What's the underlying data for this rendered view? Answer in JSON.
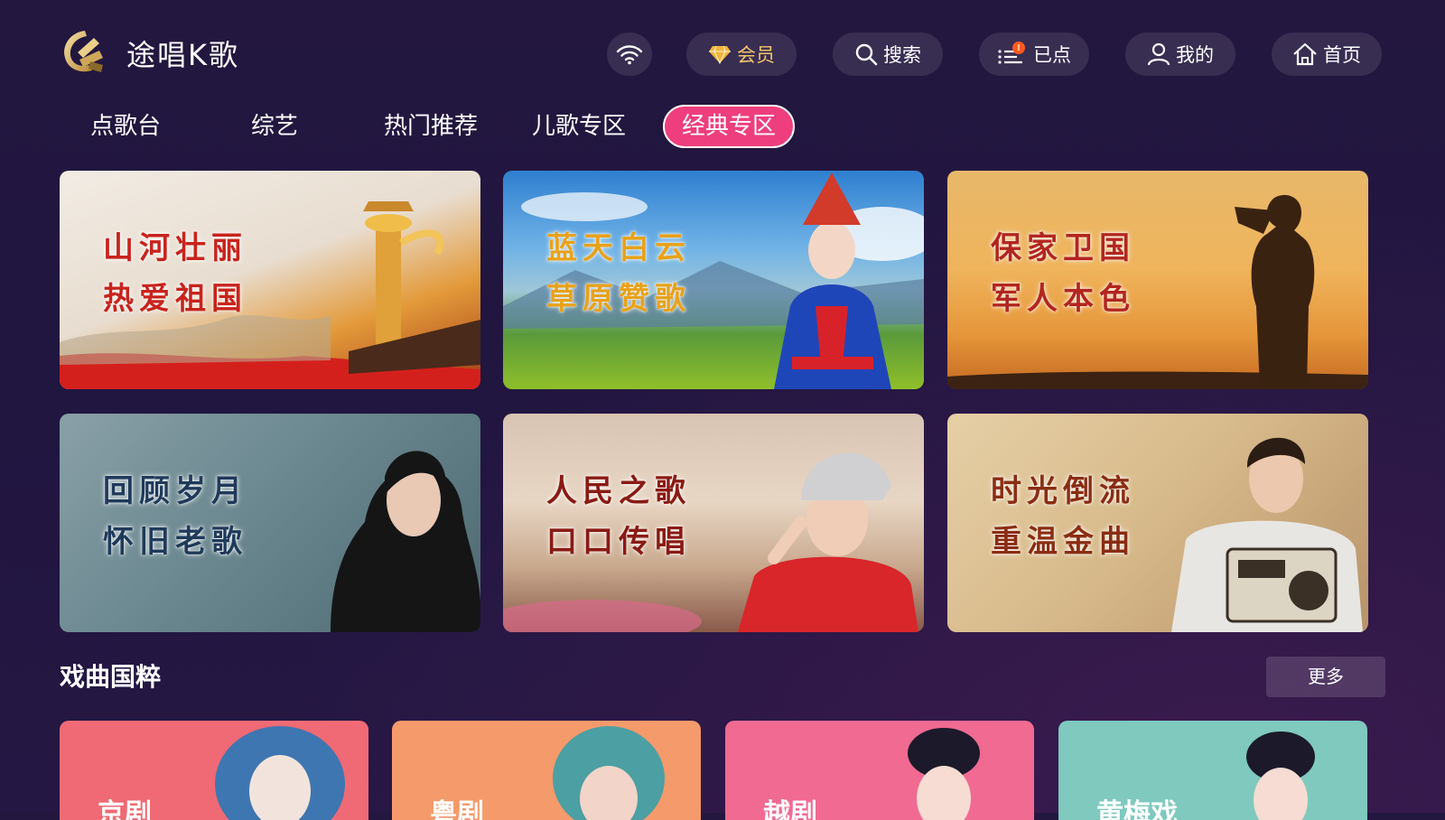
{
  "app": {
    "title": "途唱K歌"
  },
  "header": {
    "wifi": {
      "icon": "wifi-icon"
    },
    "member": {
      "label": "会员",
      "icon": "diamond-icon",
      "icon_color": "#f0b43a"
    },
    "search": {
      "label": "搜索",
      "icon": "search-icon"
    },
    "queued": {
      "label": "已点",
      "icon": "playlist-icon",
      "badge_color": "#ff5a1f"
    },
    "mine": {
      "label": "我的",
      "icon": "user-icon"
    },
    "home": {
      "label": "首页",
      "icon": "home-icon"
    }
  },
  "tabs": [
    {
      "label": "点歌台",
      "active": false
    },
    {
      "label": "综艺",
      "active": false
    },
    {
      "label": "热门推荐",
      "active": false
    },
    {
      "label": "儿歌专区",
      "active": false
    },
    {
      "label": "经典专区",
      "active": true
    }
  ],
  "colors": {
    "accent": "#ee3e7d",
    "background": "#211640"
  },
  "banners": [
    {
      "line1": "山河壮丽",
      "line2": "热爱祖国",
      "text_color": "#c8231c"
    },
    {
      "line1": "蓝天白云",
      "line2": "草原赞歌",
      "text_color": "#e8a21a"
    },
    {
      "line1": "保家卫国",
      "line2": "军人本色",
      "text_color": "#b3261e"
    },
    {
      "line1": "回顾岁月",
      "line2": "怀旧老歌",
      "text_color": "#1f3a5a"
    },
    {
      "line1": "人民之歌",
      "line2": "口口传唱",
      "text_color": "#8a1a14"
    },
    {
      "line1": "时光倒流",
      "line2": "重温金曲",
      "text_color": "#8a2d12"
    }
  ],
  "opera_section": {
    "title": "戏曲国粹",
    "more_label": "更多",
    "items": [
      {
        "name": "京剧",
        "color": "#ef6a74"
      },
      {
        "name": "粤剧",
        "color": "#f59a6b"
      },
      {
        "name": "越剧",
        "color": "#f06a92"
      },
      {
        "name": "黄梅戏",
        "color": "#7fc9bf"
      }
    ]
  }
}
